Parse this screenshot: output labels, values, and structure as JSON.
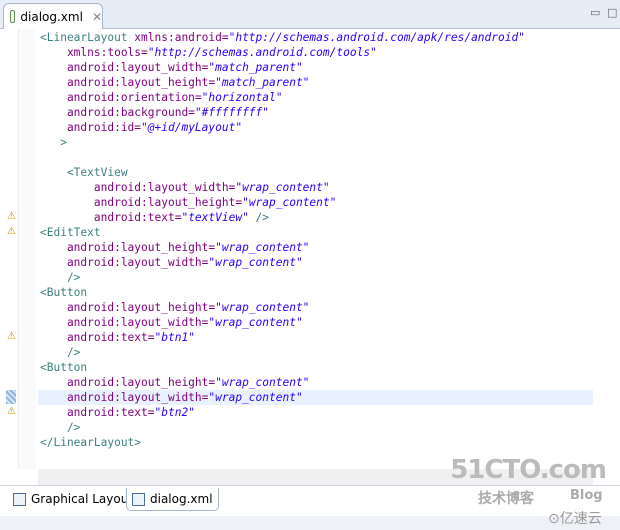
{
  "tab": {
    "title": "dialog.xml",
    "close": "✕"
  },
  "bottom_tabs": [
    {
      "label": "Graphical Layout"
    },
    {
      "label": "dialog.xml"
    }
  ],
  "watermark": {
    "site": "51CTO.com",
    "sub": "技术博客",
    "blog": "Blog",
    "brand": "⊙亿速云"
  },
  "code": [
    [
      [
        "t",
        "<LinearLayout "
      ],
      [
        "a",
        "xmlns:android="
      ],
      [
        "v",
        "\"http://schemas.android.com/apk/res/android\""
      ]
    ],
    [
      [
        "a",
        "    xmlns:tools="
      ],
      [
        "v",
        "\"http://schemas.android.com/tools\""
      ]
    ],
    [
      [
        "a",
        "    android:layout_width="
      ],
      [
        "v",
        "\"match_parent\""
      ]
    ],
    [
      [
        "a",
        "    android:layout_height="
      ],
      [
        "v",
        "\"match_parent\""
      ]
    ],
    [
      [
        "a",
        "    android:orientation="
      ],
      [
        "v",
        "\"horizontal\""
      ]
    ],
    [
      [
        "a",
        "    android:background="
      ],
      [
        "v",
        "\"#ffffffff\""
      ]
    ],
    [
      [
        "a",
        "    android:id="
      ],
      [
        "v",
        "\"@+id/myLayout\""
      ]
    ],
    [
      [
        "t",
        "   >"
      ]
    ],
    [],
    [
      [
        "t",
        "    <TextView"
      ]
    ],
    [
      [
        "a",
        "        android:layout_width="
      ],
      [
        "v",
        "\"wrap_content\""
      ]
    ],
    [
      [
        "a",
        "        android:layout_height="
      ],
      [
        "v",
        "\"wrap_content\""
      ]
    ],
    [
      [
        "a",
        "        android:text="
      ],
      [
        "v",
        "\"textView\""
      ],
      [
        "t",
        " />"
      ]
    ],
    [
      [
        "t",
        "<EditText"
      ]
    ],
    [
      [
        "a",
        "    android:layout_height="
      ],
      [
        "v",
        "\"wrap_content\""
      ]
    ],
    [
      [
        "a",
        "    android:layout_width="
      ],
      [
        "v",
        "\"wrap_content\""
      ]
    ],
    [
      [
        "t",
        "    />"
      ]
    ],
    [
      [
        "t",
        "<Button"
      ]
    ],
    [
      [
        "a",
        "    android:layout_height="
      ],
      [
        "v",
        "\"wrap_content\""
      ]
    ],
    [
      [
        "a",
        "    android:layout_width="
      ],
      [
        "v",
        "\"wrap_content\""
      ]
    ],
    [
      [
        "a",
        "    android:text="
      ],
      [
        "v",
        "\"btn1\""
      ]
    ],
    [
      [
        "t",
        "    />"
      ]
    ],
    [
      [
        "t",
        "<Button"
      ]
    ],
    [
      [
        "a",
        "    android:layout_height="
      ],
      [
        "v",
        "\"wrap_content\""
      ]
    ],
    [
      [
        "a",
        "    android:layout_width="
      ],
      [
        "v",
        "\"wrap_content\""
      ]
    ],
    [
      [
        "a",
        "    android:text="
      ],
      [
        "v",
        "\"btn2\""
      ]
    ],
    [
      [
        "t",
        "    />"
      ]
    ],
    [
      [
        "t",
        "</LinearLayout>"
      ]
    ]
  ],
  "warning_lines": [
    12,
    13,
    20,
    25
  ],
  "current_line": 24
}
